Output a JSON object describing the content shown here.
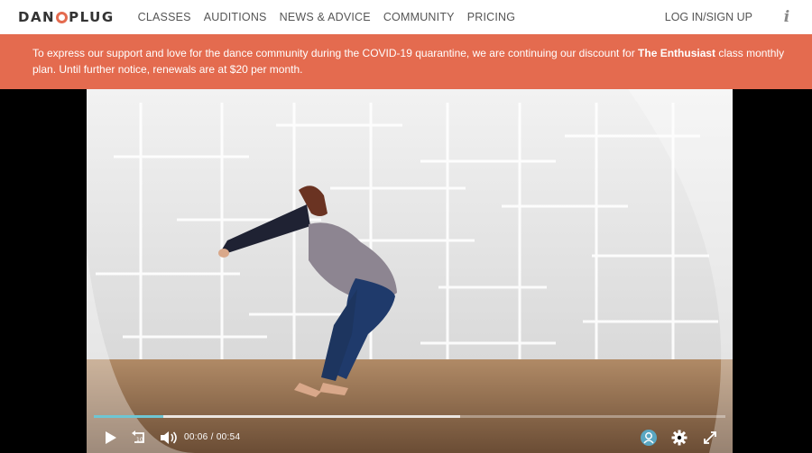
{
  "header": {
    "logo_text_left": "DAN",
    "logo_text_right": "PLUG",
    "nav": [
      "CLASSES",
      "AUDITIONS",
      "NEWS & ADVICE",
      "COMMUNITY",
      "PRICING"
    ],
    "login": "LOG IN/SIGN UP",
    "info_icon": "info-icon"
  },
  "banner": {
    "text_before": "To express our support and love for the dance community during the COVID-19 quarantine, we are continuing our discount for ",
    "highlight": "The Enthusiast",
    "text_after": " class monthly plan. Until further notice, renewals are at $20 per month."
  },
  "player": {
    "current_time": "00:06",
    "separator": "/",
    "duration": "00:54",
    "progress_fraction": 0.11,
    "buffered_fraction": 0.58,
    "icons": [
      "play-icon",
      "replay-10-icon",
      "volume-icon",
      "chat-icon",
      "settings-gear-icon",
      "fullscreen-icon"
    ],
    "accent_color": "#6ec6d3"
  },
  "colors": {
    "brand": "#e46b4f",
    "banner_text": "#ffffff"
  }
}
